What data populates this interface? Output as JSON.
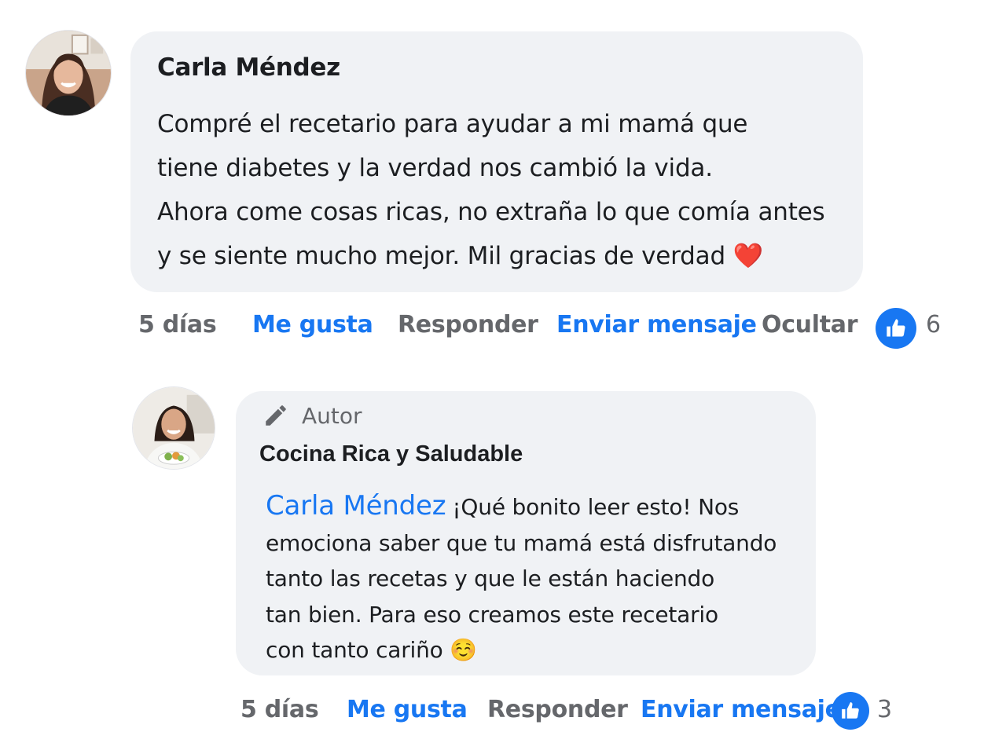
{
  "comment": {
    "author": "Carla Méndez",
    "lines": [
      "Compré el recetario para ayudar a mi mamá que",
      "tiene diabetes y la verdad nos cambió la vida.",
      "Ahora come cosas ricas, no extraña lo que comía antes",
      "y se siente mucho mejor. Mil gracias de verdad"
    ],
    "emoji": "❤️",
    "time": "5 días",
    "like_label": "Me gusta",
    "reply_label": "Responder",
    "message_label": "Enviar mensaje",
    "hide_label": "Ocultar",
    "like_count": "6"
  },
  "reply": {
    "badge": "Autor",
    "author": "Cocina Rica y Saludable",
    "mention": "Carla Méndez",
    "lines": [
      "¡Qué bonito leer esto! Nos",
      "emociona saber que tu mamá está disfrutando",
      "tanto las recetas y que le están haciendo",
      "tan bien. Para eso creamos este recetario",
      "con tanto cariño"
    ],
    "emoji": "☺️",
    "time": "5 días",
    "like_label": "Me gusta",
    "reply_label": "Responder",
    "message_label": "Enviar mensaje",
    "like_count": "3"
  },
  "colors": {
    "accent": "#1877f2",
    "muted": "#65676b",
    "bubble": "#f0f2f5"
  },
  "icons": [
    "avatar-photo",
    "pencil-icon",
    "thumbs-up-icon"
  ]
}
